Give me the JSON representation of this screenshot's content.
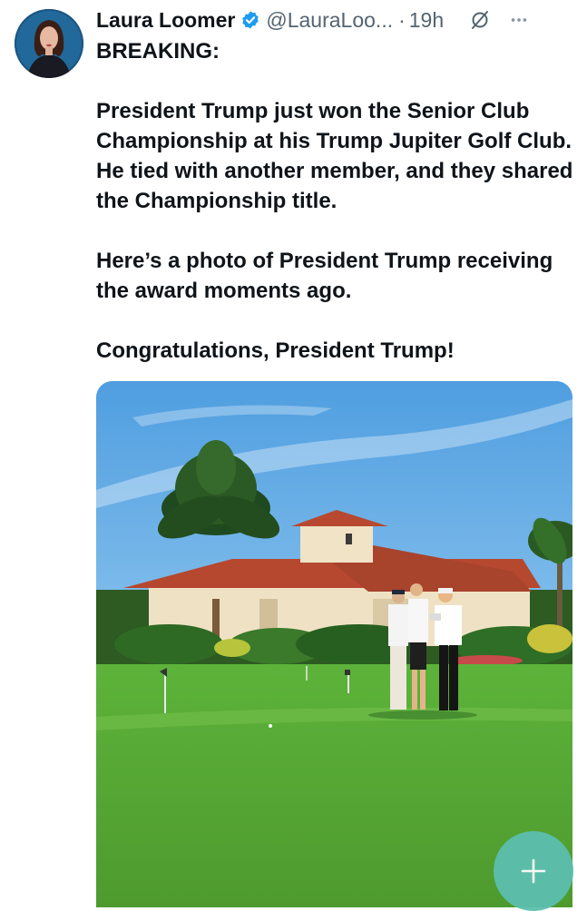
{
  "tweet": {
    "author_name": "Laura Loomer",
    "handle": "@LauraLoo...",
    "separator": "·",
    "time": "19h",
    "paragraphs": [
      "BREAKING:",
      "President Trump just won the Senior Club Championship at his Trump Jupiter Golf Club. He tied with another member, and they shared the Championship title.",
      "Here’s a photo of President Trump receiving the award moments ago.",
      "Congratulations, President Trump!"
    ]
  },
  "icons": {
    "verified": "verified-badge-icon",
    "grok": "grok-icon",
    "more": "more-options-icon",
    "compose": "plus-icon"
  },
  "colors": {
    "verified_blue": "#1d9bf0",
    "secondary_text": "#536471",
    "fab": "#5cbfae"
  }
}
